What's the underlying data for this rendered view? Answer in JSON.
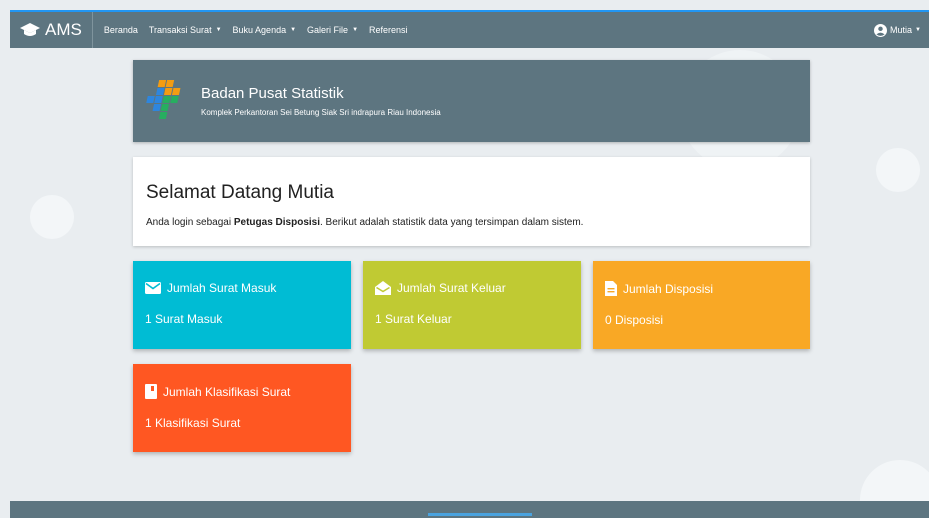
{
  "navbar": {
    "brand": "AMS",
    "items": [
      {
        "label": "Beranda",
        "dropdown": false
      },
      {
        "label": "Transaksi Surat",
        "dropdown": true
      },
      {
        "label": "Buku Agenda",
        "dropdown": true
      },
      {
        "label": "Galeri File",
        "dropdown": true
      },
      {
        "label": "Referensi",
        "dropdown": false
      }
    ],
    "user": "Mutia",
    "caret": "▼"
  },
  "institution": {
    "name": "Badan Pusat Statistik",
    "address": "Komplek Perkantoran Sei Betung Siak Sri indrapura Riau Indonesia"
  },
  "welcome": {
    "title": "Selamat Datang Mutia",
    "text_before": "Anda login sebagai ",
    "role": "Petugas Disposisi",
    "text_after": ". Berikut adalah statistik data yang tersimpan dalam sistem."
  },
  "stats": [
    {
      "title": "Jumlah Surat Masuk",
      "value": "1 Surat Masuk",
      "color": "#00bcd4",
      "icon": "mail-icon"
    },
    {
      "title": "Jumlah Surat Keluar",
      "value": "1 Surat Keluar",
      "color": "#c0ca33",
      "icon": "mail-open-icon"
    },
    {
      "title": "Jumlah Disposisi",
      "value": "0 Disposisi",
      "color": "#f9a825",
      "icon": "file-icon"
    },
    {
      "title": "Jumlah Klasifikasi Surat",
      "value": "1 Klasifikasi Surat",
      "color": "#ff5722",
      "icon": "book-icon"
    }
  ],
  "colors": {
    "navbar": "#5d7580",
    "accent": "#2196f3"
  }
}
